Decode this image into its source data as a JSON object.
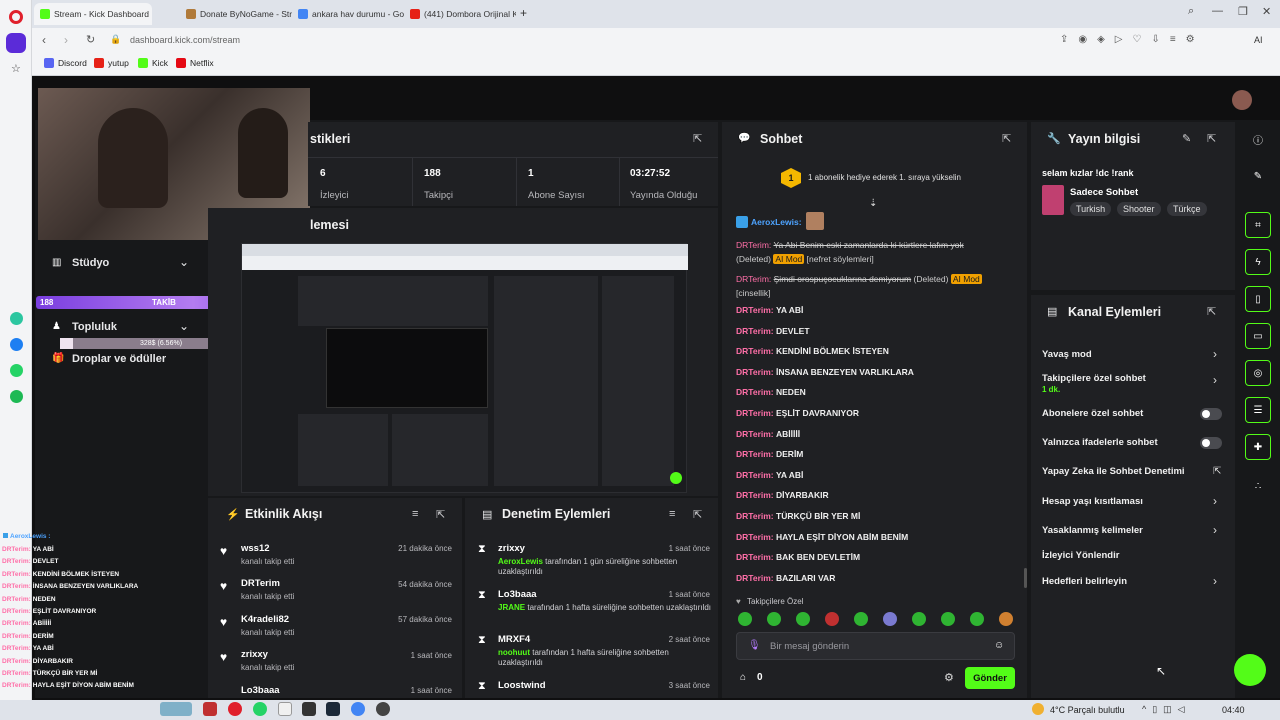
{
  "browser": {
    "tabs": [
      {
        "label": "Stream - Kick Dashboard",
        "color": "#53fc18"
      },
      {
        "label": "Donate ByNoGame - Strea",
        "color": "#b07a3a"
      },
      {
        "label": "ankara hav durumu - Goo",
        "color": "#4285f4"
      },
      {
        "label": "(441) Dombora Orijinal Kl",
        "color": "#e62117"
      }
    ],
    "address": "dashboard.kick.com/stream",
    "bookmarks": [
      {
        "label": "Discord",
        "color": "#5865f2"
      },
      {
        "label": "yutup",
        "color": "#e62117"
      },
      {
        "label": "Kick",
        "color": "#53fc18"
      },
      {
        "label": "Netflix",
        "color": "#e50914"
      }
    ],
    "ai_label": "AI"
  },
  "left_nav": {
    "studio": "Stüdyo",
    "community": "Topluluk",
    "drops": "Droplar ve ödüller"
  },
  "overlay": {
    "follow_left": "188",
    "follow_label": "TAKİB",
    "follow_right": "200",
    "progress_text": "328$ (6.56%)"
  },
  "stats": {
    "title": "stikleri",
    "items": [
      {
        "value": "6",
        "label": "İzleyici"
      },
      {
        "value": "188",
        "label": "Takipçi"
      },
      {
        "value": "1",
        "label": "Abone Sayısı"
      },
      {
        "value": "03:27:52",
        "label": "Yayında Olduğu"
      }
    ]
  },
  "preview": {
    "title": "lemesi"
  },
  "activity": {
    "title": "Etkinlik Akışı",
    "items": [
      {
        "name": "wss12",
        "desc": "kanalı takip etti",
        "time": "21 dakika önce"
      },
      {
        "name": "DRTerim",
        "desc": "kanalı takip etti",
        "time": "54 dakika önce"
      },
      {
        "name": "K4radeli82",
        "desc": "kanalı takip etti",
        "time": "57 dakika önce"
      },
      {
        "name": "zrixxy",
        "desc": "kanalı takip etti",
        "time": "1 saat önce"
      },
      {
        "name": "Lo3baaa",
        "desc": "",
        "time": "1 saat önce"
      }
    ]
  },
  "moderation": {
    "title": "Denetim Eylemleri",
    "items": [
      {
        "name": "zrixxy",
        "mod": "AeroxLewis",
        "text": "tarafından 1 gün süreliğine sohbetten uzaklaştırıldı",
        "time": "1 saat önce"
      },
      {
        "name": "Lo3baaa",
        "mod": "JRANE",
        "text": "tarafından 1 hafta süreliğine sohbetten uzaklaştırıldı",
        "time": "1 saat önce"
      },
      {
        "name": "MRXF4",
        "mod": "noohuut",
        "text": "tarafından 1 hafta süreliğine sohbetten uzaklaştırıldı",
        "time": "2 saat önce"
      },
      {
        "name": "Loostwind",
        "mod": "",
        "text": "",
        "time": "3 saat önce"
      }
    ]
  },
  "chat": {
    "title": "Sohbet",
    "gift_badge": "1",
    "gift_text": "1 abonelik hediye ederek 1. sıraya yükselin",
    "first_user": "AeroxLewis:",
    "deleted1_user": "DRTerim:",
    "deleted1_text": "Ya Abi Benim eski zamanlarda ki kürtlere lafım yok",
    "deleted1_tag": "(Deleted)",
    "deleted1_ai": "AI Mod",
    "deleted1_reason": "[nefret söylemleri]",
    "deleted2_user": "DRTerim:",
    "deleted2_text": "Şimdi orospuçocuklarına demiyorum",
    "deleted2_tag": "(Deleted)",
    "deleted2_ai": "AI Mod",
    "deleted2_reason": "[cinsellik]",
    "messages": [
      {
        "user": "DRTerim:",
        "text": "YA ABİ"
      },
      {
        "user": "DRTerim:",
        "text": "DEVLET"
      },
      {
        "user": "DRTerim:",
        "text": "KENDİNİ BÖLMEK İSTEYEN"
      },
      {
        "user": "DRTerim:",
        "text": "İNSANA BENZEYEN VARLIKLARA"
      },
      {
        "user": "DRTerim:",
        "text": "NEDEN"
      },
      {
        "user": "DRTerim:",
        "text": "EŞLİT DAVRANIYOR"
      },
      {
        "user": "DRTerim:",
        "text": "ABİİİİİ"
      },
      {
        "user": "DRTerim:",
        "text": "DERİM"
      },
      {
        "user": "DRTerim:",
        "text": "YA ABİ"
      },
      {
        "user": "DRTerim:",
        "text": "DİYARBAKIR"
      },
      {
        "user": "DRTerim:",
        "text": "TÜRKÇÜ BİR YER Mİ"
      },
      {
        "user": "DRTerim:",
        "text": "HAYLA EŞİT DİYON ABİM BENİM"
      },
      {
        "user": "DRTerim:",
        "text": "BAK BEN DEVLETİM"
      },
      {
        "user": "DRTerim:",
        "text": "BAZILARI VAR"
      }
    ],
    "followers_only": "Takipçilere Özel",
    "input_placeholder": "Bir mesaj gönderin",
    "points": "0",
    "send_label": "Gönder"
  },
  "stream_info": {
    "title": "Yayın bilgisi",
    "stream_title": "selam kızlar !dc !rank",
    "category": "Sadece Sohbet",
    "tags": [
      "Turkish",
      "Shooter",
      "Türkçe"
    ]
  },
  "channel_actions": {
    "title": "Kanal Eylemleri",
    "items": [
      {
        "label": "Yavaş mod",
        "kind": "chevron"
      },
      {
        "label": "Takipçilere özel sohbet",
        "kind": "chevron",
        "sub": "1 dk."
      },
      {
        "label": "Abonelere özel sohbet",
        "kind": "toggle"
      },
      {
        "label": "Yalnızca ifadelerle sohbet",
        "kind": "toggle"
      },
      {
        "label": "Yapay Zeka ile Sohbet Denetimi",
        "kind": "external"
      },
      {
        "label": "Hesap yaşı kısıtlaması",
        "kind": "chevron"
      },
      {
        "label": "Yasaklanmış kelimeler",
        "kind": "chevron"
      },
      {
        "label": "İzleyici Yönlendir",
        "kind": "none"
      },
      {
        "label": "Hedefleri belirleyin",
        "kind": "chevron"
      }
    ]
  },
  "mini_chat": {
    "first_user": "AeroxLewis :",
    "lines": [
      "YA ABİ",
      "DEVLET",
      "KENDİNİ BÖLMEK İSTEYEN",
      "İNSANA BENZEYEN VARLIKLARA",
      "NEDEN",
      "EŞLİT DAVRANIYOR",
      "ABİİİİİ",
      "DERİM",
      "YA ABİ",
      "DİYARBAKIR",
      "TÜRKÇÜ BİR YER Mİ",
      "HAYLA EŞİT DİYON ABİM BENİM"
    ]
  },
  "taskbar": {
    "weather": "4°C  Parçalı bulutlu",
    "time": "04:40"
  },
  "colors": {
    "accent": "#53fc18",
    "danger": "#ff6fa8",
    "panel": "#1f2023"
  }
}
